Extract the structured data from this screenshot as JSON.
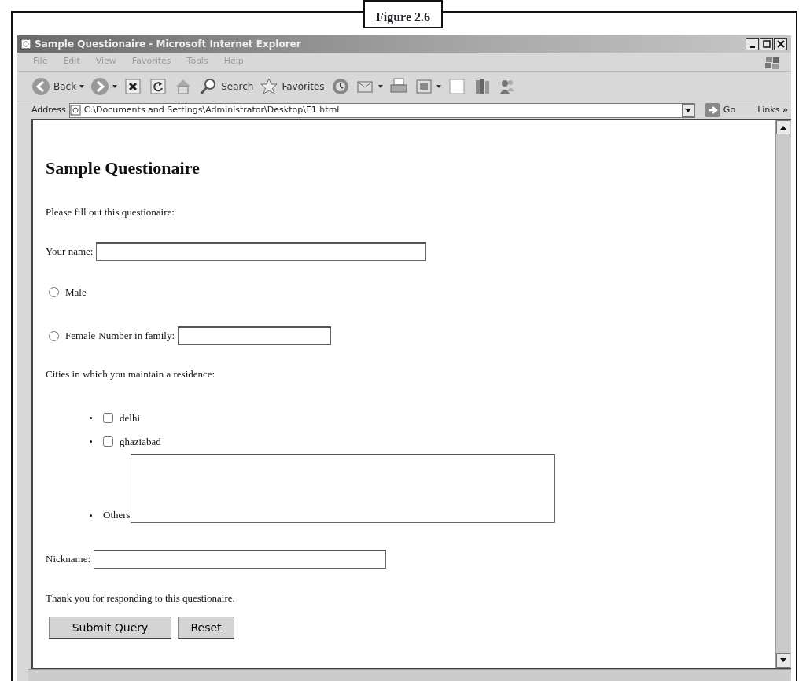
{
  "figure_label": "Figure 2.6",
  "window": {
    "title": "Sample Questionaire - Microsoft Internet Explorer"
  },
  "menu": [
    "File",
    "Edit",
    "View",
    "Favorites",
    "Tools",
    "Help"
  ],
  "toolbar": [
    {
      "kind": "back",
      "label": "Back"
    },
    {
      "kind": "forward"
    },
    {
      "kind": "stop"
    },
    {
      "kind": "refresh"
    },
    {
      "kind": "home"
    },
    {
      "kind": "search",
      "label": "Search"
    },
    {
      "kind": "favorites",
      "label": "Favorites"
    },
    {
      "kind": "history"
    },
    {
      "kind": "mail"
    },
    {
      "kind": "print"
    },
    {
      "kind": "edit"
    },
    {
      "kind": "discuss"
    },
    {
      "kind": "research"
    },
    {
      "kind": "messenger"
    }
  ],
  "address": {
    "label": "Address",
    "value": "C:\\Documents and Settings\\Administrator\\Desktop\\E1.html",
    "go": "Go",
    "links": "Links",
    "links_chevron": "»"
  },
  "page": {
    "heading": "Sample Questionaire",
    "intro": "Please fill out this questionaire:",
    "name_label": "Your name:",
    "radios": [
      {
        "label": "Male",
        "selected": false
      },
      {
        "label": "Female",
        "selected": false
      }
    ],
    "family_label": "Number in family:",
    "cities_label": "Cities in which you maintain a residence:",
    "cities": [
      {
        "label": "delhi",
        "checked": false
      },
      {
        "label": "ghaziabad",
        "checked": false
      }
    ],
    "others_label": "Others",
    "nickname_label": "Nickname:",
    "thanks": "Thank you for responding to this questionaire.",
    "buttons": [
      "Submit Query",
      "Reset"
    ]
  }
}
